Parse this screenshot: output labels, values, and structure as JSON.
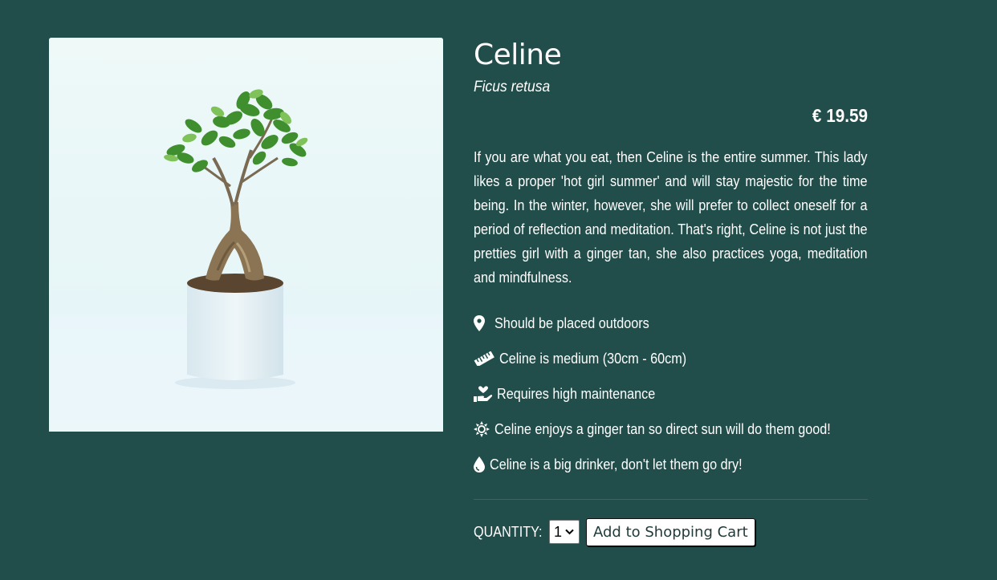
{
  "product": {
    "name": "Celine",
    "latin_name": "Ficus retusa",
    "price": "€ 19.59",
    "image_alt": "Bonsai ficus in a white pot",
    "description": "If you are what you eat, then Celine is the entire summer. This lady likes a proper 'hot girl summer' and will stay majestic for the time being. In the winter, however, she will prefer to collect oneself for a period of reflection and meditation. That's right, Celine is not just the pretties girl with a ginger tan, she also practices yoga, meditation and mindfulness."
  },
  "features": [
    {
      "icon": "map-marker-icon",
      "text": "Should be placed outdoors"
    },
    {
      "icon": "ruler-icon",
      "text": "Celine is medium (30cm - 60cm)"
    },
    {
      "icon": "hand-holding-heart-icon",
      "text": "Requires high maintenance"
    },
    {
      "icon": "sun-icon",
      "text": "Celine enjoys a ginger tan so direct sun will do them good!"
    },
    {
      "icon": "water-drop-icon",
      "text": "Celine is a big drinker, don't let them go dry!"
    }
  ],
  "cart": {
    "quantity_label": "QUANTITY:",
    "quantity_value": "1",
    "add_button_label": "Add to Shopping Cart"
  },
  "colors": {
    "background": "#214e4b",
    "text": "#ffffff",
    "button_bg": "#ffffff"
  }
}
